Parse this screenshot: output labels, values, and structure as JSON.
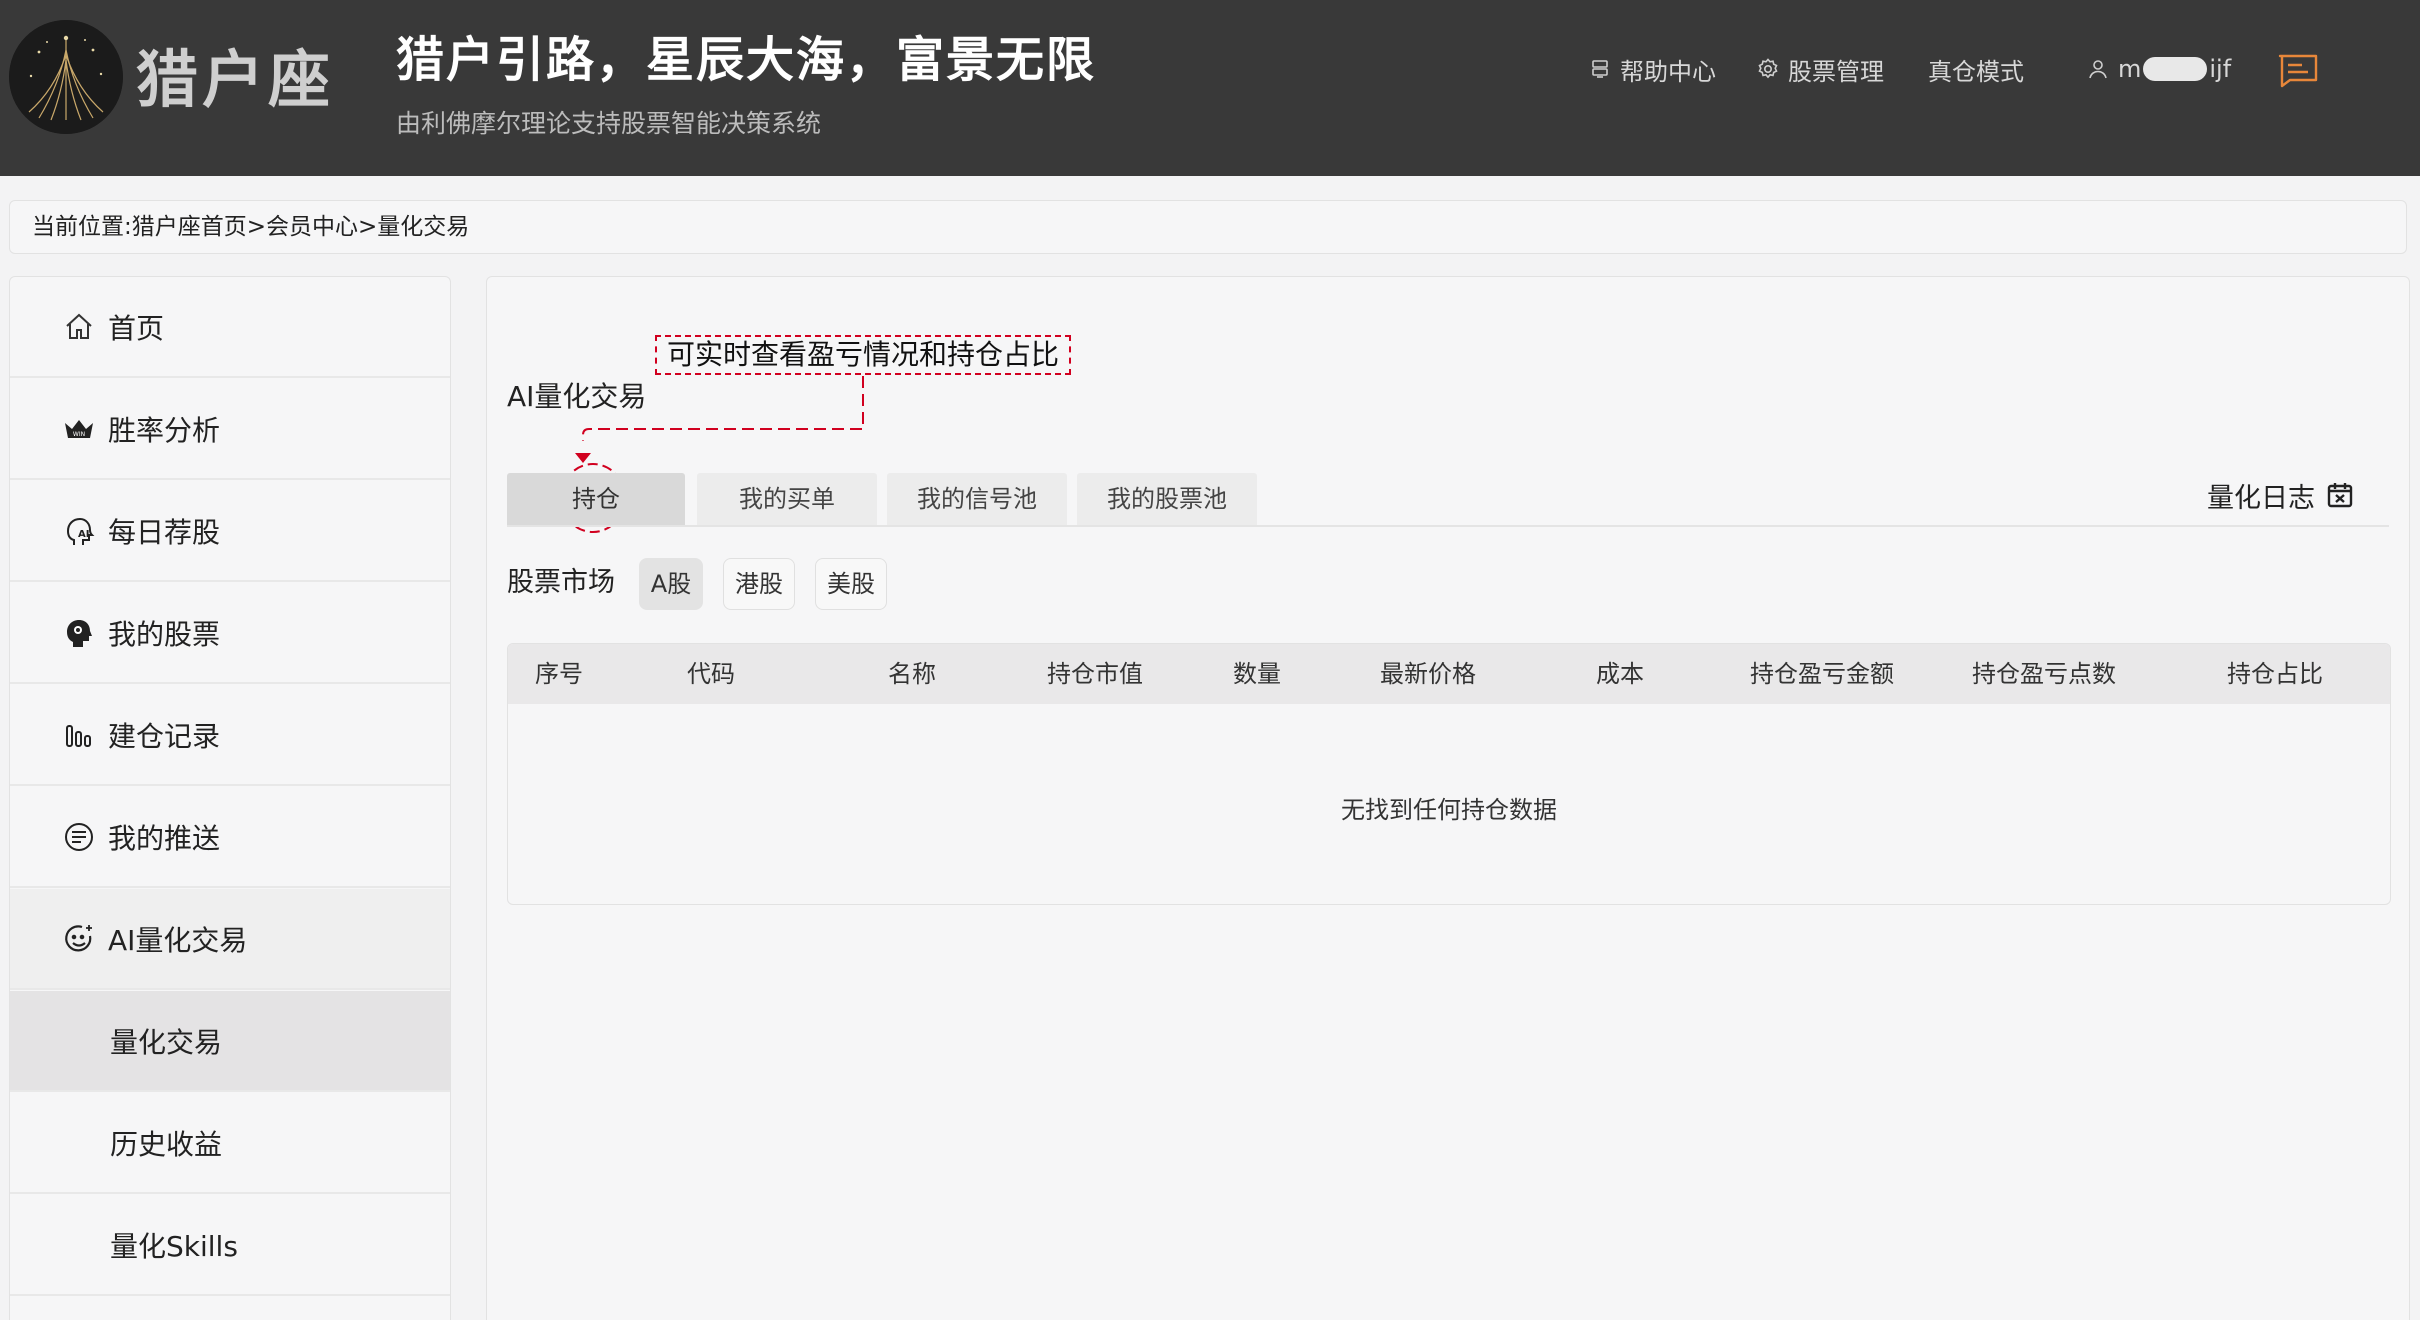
{
  "header": {
    "brand": "猎户座",
    "slogan": "猎户引路，星辰大海，富景无限",
    "subslogan": "由利佛摩尔理论支持股票智能决策系统",
    "nav": {
      "help": "帮助中心",
      "stock_manage": "股票管理",
      "real_mode": "真仓模式",
      "user_prefix": "m",
      "user_suffix": "ijf"
    }
  },
  "breadcrumb": "当前位置:猎户座首页>会员中心>量化交易",
  "sidebar": {
    "items": [
      {
        "label": "首页",
        "icon": "home-icon"
      },
      {
        "label": "胜率分析",
        "icon": "crown-win-icon"
      },
      {
        "label": "每日荐股",
        "icon": "ai-head-icon"
      },
      {
        "label": "我的股票",
        "icon": "brain-head-icon"
      },
      {
        "label": "建仓记录",
        "icon": "bar-chart-icon"
      },
      {
        "label": "我的推送",
        "icon": "push-message-icon"
      },
      {
        "label": "AI量化交易",
        "icon": "ai-smile-icon"
      },
      {
        "label": "量化交易",
        "icon": ""
      },
      {
        "label": "历史收益",
        "icon": ""
      },
      {
        "label": "量化Skills",
        "icon": ""
      }
    ]
  },
  "main": {
    "title": "AI量化交易",
    "callout": "可实时查看盈亏情况和持仓占比",
    "tabs": [
      "持仓",
      "我的买单",
      "我的信号池",
      "我的股票池"
    ],
    "log_link": "量化日志",
    "market_label": "股票市场",
    "markets": [
      "A股",
      "港股",
      "美股"
    ],
    "table": {
      "columns": [
        "序号",
        "代码",
        "名称",
        "持仓市值",
        "数量",
        "最新价格",
        "成本",
        "持仓盈亏金额",
        "持仓盈亏点数",
        "持仓占比"
      ],
      "empty": "无找到任何持仓数据"
    }
  },
  "colors": {
    "header_bg": "#393939",
    "callout_red": "#d1001f",
    "message_icon": "#e8873a"
  }
}
